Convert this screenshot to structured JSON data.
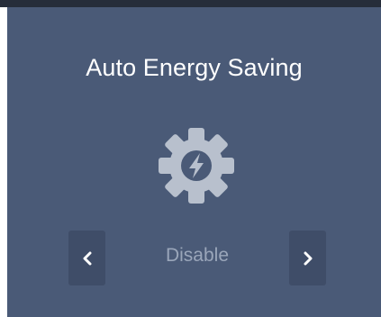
{
  "widget": {
    "title": "Auto Energy Saving",
    "value": "Disable",
    "icon": "energy-gear-icon",
    "prev_icon": "chevron-left-icon",
    "next_icon": "chevron-right-icon"
  },
  "colors": {
    "panel": "#4a5a77",
    "button": "#3f4d68",
    "title": "#ffffff",
    "value": "#9aa6ba",
    "icon": "#b8c0cd"
  }
}
